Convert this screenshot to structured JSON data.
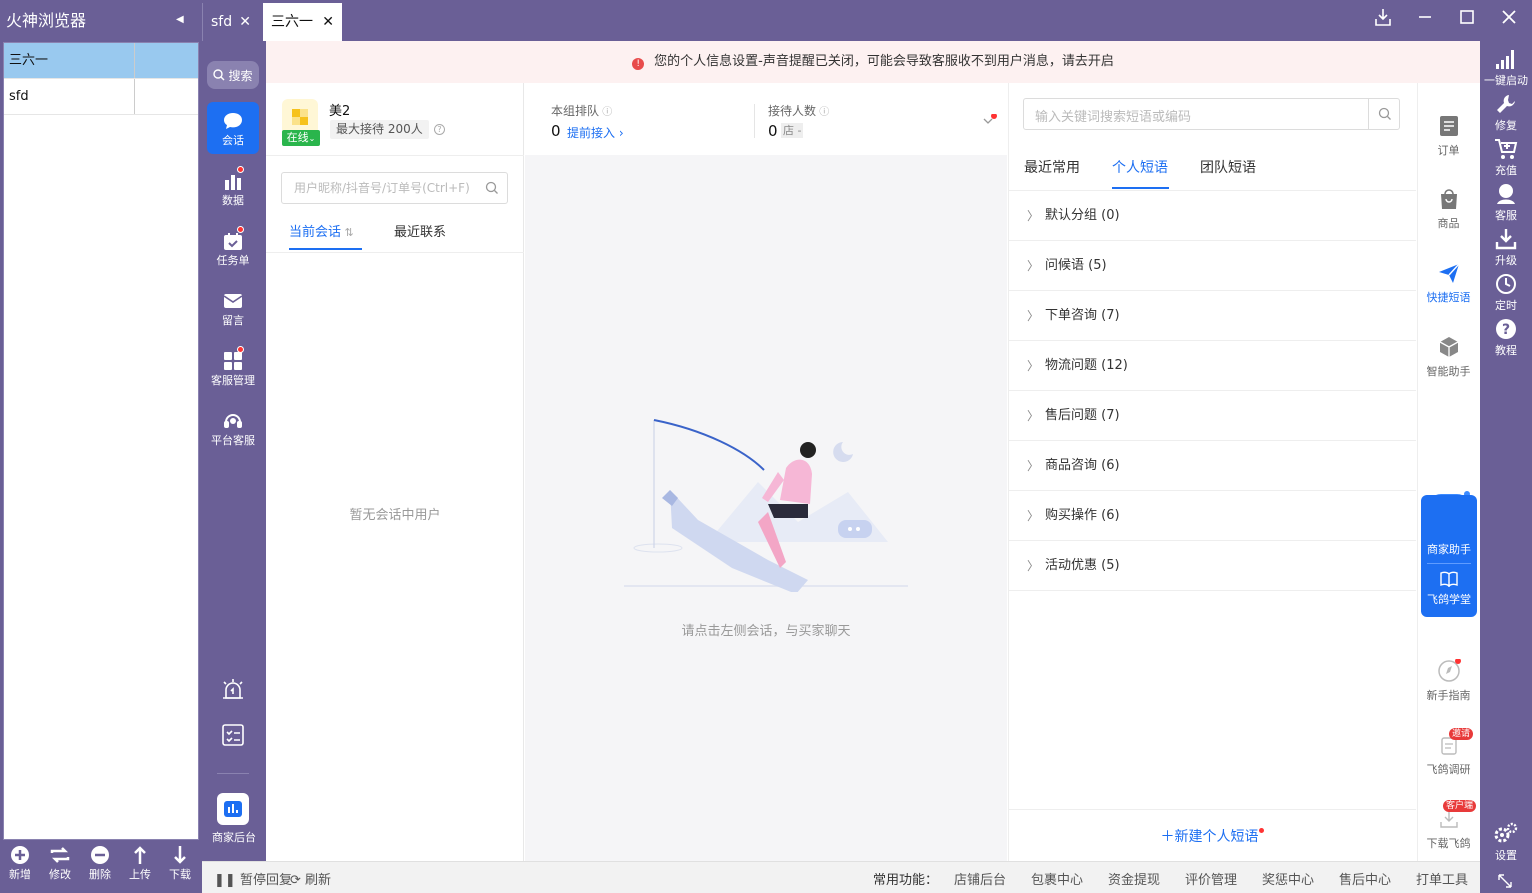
{
  "browser": {
    "title": "火神浏览器"
  },
  "accounts": [
    {
      "name": "三六一",
      "selected": true
    },
    {
      "name": "sfd",
      "selected": false
    }
  ],
  "left_tools": [
    {
      "label": "新增",
      "icon": "plus-circle-icon"
    },
    {
      "label": "修改",
      "icon": "refresh-icon"
    },
    {
      "label": "删除",
      "icon": "minus-circle-icon"
    },
    {
      "label": "上传",
      "icon": "arrow-up-icon"
    },
    {
      "label": "下载",
      "icon": "arrow-down-icon"
    }
  ],
  "tabs": [
    {
      "label": "sfd",
      "active": false
    },
    {
      "label": "三六一",
      "active": true
    }
  ],
  "banner": {
    "text": "您的个人信息设置-声音提醒已关闭，可能会导致客服收不到用户消息，请去开启"
  },
  "nav": {
    "search_label": "搜索",
    "items": [
      {
        "label": "会话",
        "icon": "chat-icon",
        "active": true,
        "dot": false
      },
      {
        "label": "数据",
        "icon": "bar-chart-icon",
        "active": false,
        "dot": true
      },
      {
        "label": "任务单",
        "icon": "calendar-check-icon",
        "active": false,
        "dot": true
      },
      {
        "label": "留言",
        "icon": "mail-icon",
        "active": false,
        "dot": false
      },
      {
        "label": "客服管理",
        "icon": "grid-icon",
        "active": false,
        "dot": true
      },
      {
        "label": "平台客服",
        "icon": "headset-icon",
        "active": false,
        "dot": false
      }
    ],
    "merchant_label": "商家后台"
  },
  "shop": {
    "name": "美2",
    "status": "在线",
    "max_receive": "最大接待 200人"
  },
  "customer": {
    "search_placeholder": "用户昵称/抖音号/订单号(Ctrl+F)",
    "tab_current": "当前会话",
    "tab_recent": "最近联系",
    "empty_text": "暂无会话中用户"
  },
  "stats": {
    "queue_label": "本组排队",
    "queue_value": "0",
    "queue_link": "提前接入",
    "recv_label": "接待人数",
    "recv_value": "0",
    "recv_tag": "店",
    "recv_dash": "-"
  },
  "chat": {
    "empty_text": "请点击左侧会话，与买家聊天"
  },
  "quick_phrases": {
    "search_placeholder": "输入关键词搜索短语或编码",
    "tabs": [
      "最近常用",
      "个人短语",
      "团队短语"
    ],
    "active_tab": "个人短语",
    "groups": [
      {
        "name": "默认分组",
        "count": "(0)"
      },
      {
        "name": "问候语",
        "count": "(5)"
      },
      {
        "name": "下单咨询",
        "count": "(7)"
      },
      {
        "name": "物流问题",
        "count": "(12)"
      },
      {
        "name": "售后问题",
        "count": "(7)"
      },
      {
        "name": "商品咨询",
        "count": "(6)"
      },
      {
        "name": "购买操作",
        "count": "(6)"
      },
      {
        "name": "活动优惠",
        "count": "(5)"
      }
    ],
    "new_label": "新建个人短语"
  },
  "right_tools": {
    "items": [
      {
        "label": "订单",
        "icon": "order-icon"
      },
      {
        "label": "商品",
        "icon": "bag-icon"
      },
      {
        "label": "快捷短语",
        "icon": "send-icon"
      },
      {
        "label": "智能助手",
        "icon": "cube-icon"
      }
    ],
    "helper_label": "商家助手",
    "school_label": "飞鸽学堂",
    "guide_label": "新手指南",
    "research_label": "飞鸽调研",
    "research_tag": "邀请",
    "download_label": "下载飞鸽",
    "download_tag": "客户端"
  },
  "far_right": [
    {
      "label": "一键启动",
      "icon": "signal-icon"
    },
    {
      "label": "修复",
      "icon": "wrench-icon"
    },
    {
      "label": "充值",
      "icon": "cart-icon"
    },
    {
      "label": "客服",
      "icon": "user-icon"
    },
    {
      "label": "升级",
      "icon": "download-icon"
    },
    {
      "label": "定时",
      "icon": "clock-icon"
    },
    {
      "label": "教程",
      "icon": "help-icon"
    }
  ],
  "settings_label": "设置",
  "bottom": {
    "pause": "暂停回复",
    "refresh": "刷新",
    "common_label": "常用功能：",
    "links": [
      "店铺后台",
      "包裹中心",
      "资金提现",
      "评价管理",
      "奖惩中心",
      "售后中心",
      "打单工具"
    ]
  },
  "colors": {
    "chrome": "#6a5f96",
    "accent": "#1d6ff2",
    "online": "#2ab54c",
    "alert": "#e84b4b"
  }
}
